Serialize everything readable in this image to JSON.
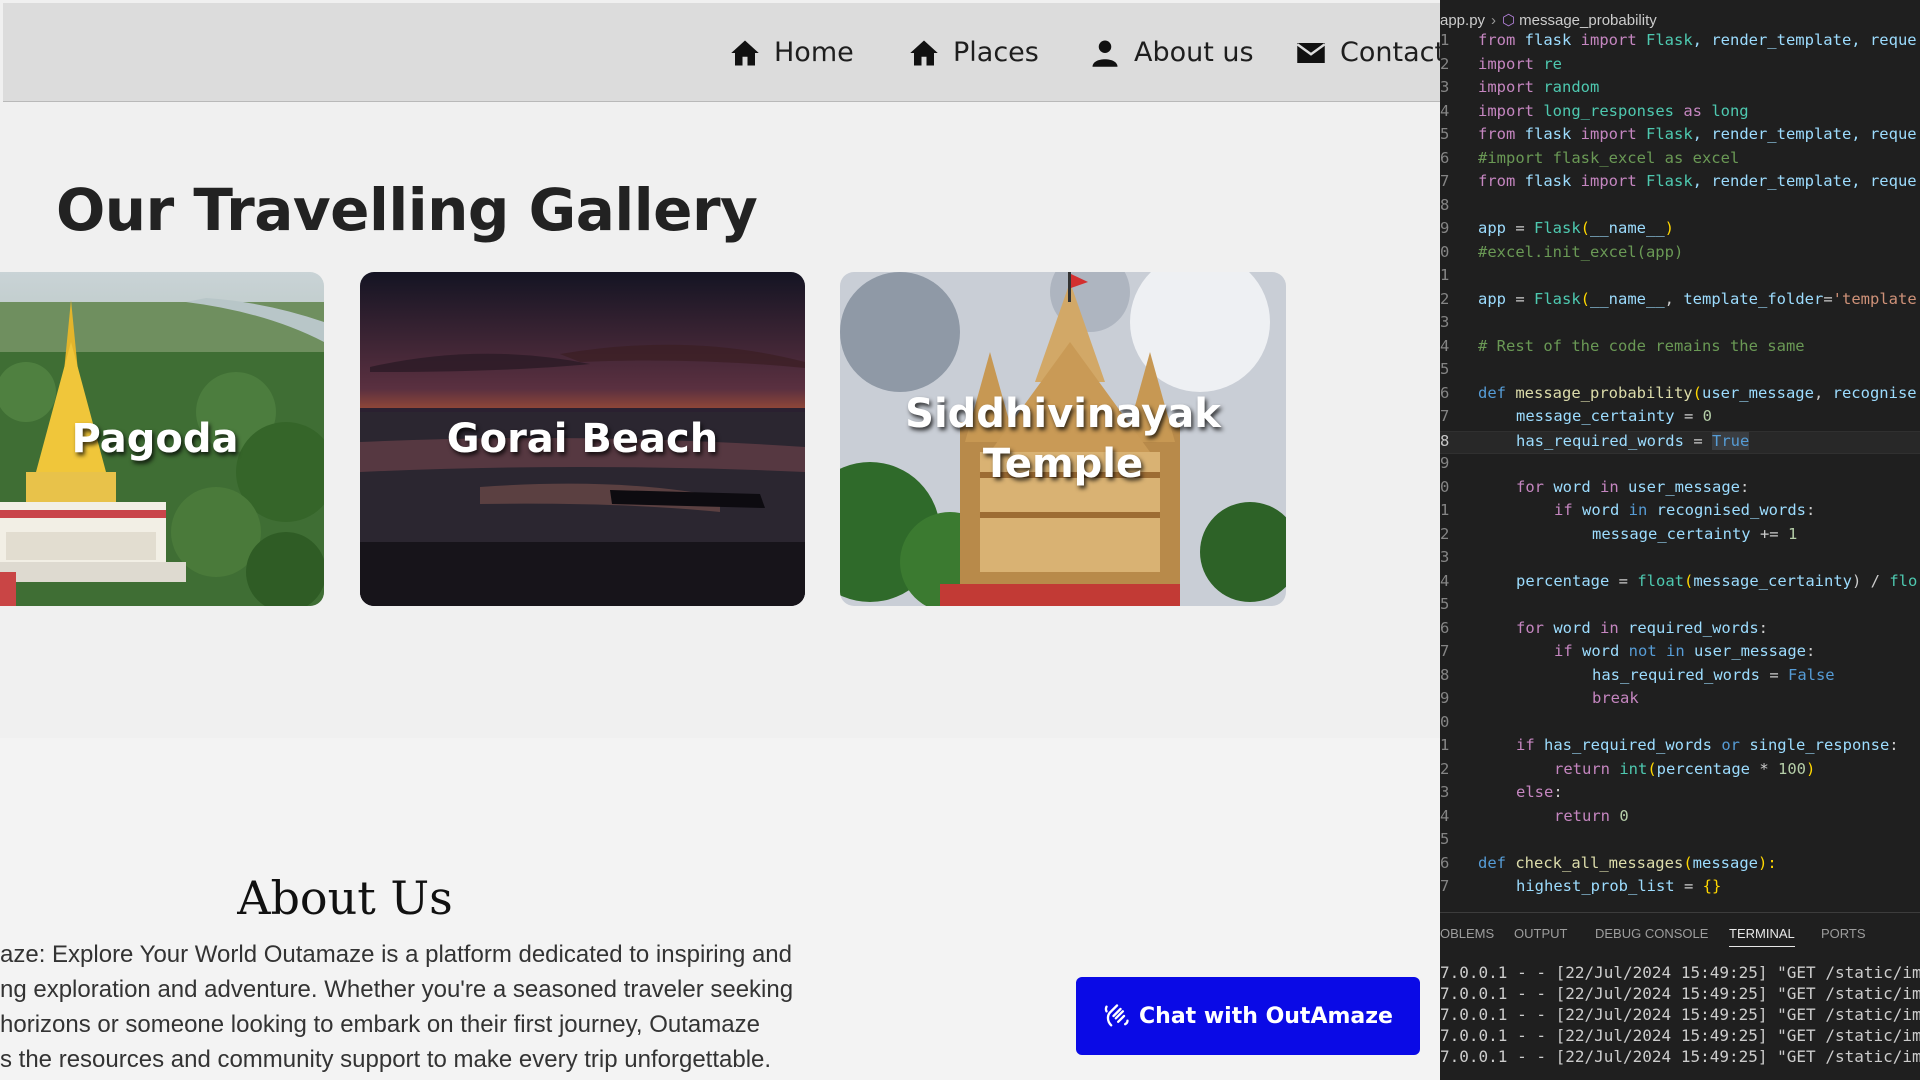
{
  "site": {
    "nav": [
      {
        "label": "Home",
        "icon": "home-icon"
      },
      {
        "label": "Places",
        "icon": "home-icon"
      },
      {
        "label": "About us",
        "icon": "user-icon"
      },
      {
        "label": "Contact",
        "icon": "envelope-icon"
      }
    ],
    "gallery_title": "Our Travelling Gallery",
    "cards": [
      {
        "label": "Pagoda"
      },
      {
        "label": "Gorai Beach"
      },
      {
        "label": "Siddhivinayak Temple"
      }
    ],
    "about_title": "About Us",
    "about_lines": [
      "aze: Explore Your World Outamaze is a platform dedicated to inspiring and",
      "ng exploration and adventure. Whether you're a seasoned traveler seeking",
      "horizons or someone looking to embark on their first journey, Outamaze",
      "s the resources and community support to make every trip unforgettable."
    ],
    "chat_button": "Chat with OutAmaze",
    "colors": {
      "chat_button": "#0a0ae6",
      "navbar": "#dcdcdc",
      "page_bg": "#f0f0f0"
    }
  },
  "editor": {
    "breadcrumb_file": "app.py",
    "breadcrumb_symbol": "message_probability",
    "line_numbers": [
      "1",
      "2",
      "3",
      "4",
      "5",
      "6",
      "7",
      "8",
      "9",
      "0",
      "1",
      "2",
      "3",
      "4",
      "5",
      "6",
      "7",
      "8",
      "9",
      "0",
      "1",
      "2",
      "3",
      "4",
      "5",
      "6",
      "7",
      "8",
      "9",
      "0",
      "1",
      "2",
      "3",
      "4",
      "5",
      "6",
      "7"
    ],
    "code": {
      "c1a": "from",
      "c1b": " flask ",
      "c1c": "import",
      "c1d": " Flask",
      "c1e": ", render_template, reque",
      "c2a": "import",
      "c2b": " re",
      "c3a": "import",
      "c3b": " random",
      "c4a": "import",
      "c4b": " long_responses ",
      "c4c": "as",
      "c4d": " long",
      "c5a": "from",
      "c5b": " flask ",
      "c5c": "import",
      "c5d": " Flask",
      "c5e": ", render_template, reque",
      "c6": "#import flask_excel as excel",
      "c7a": "from",
      "c7b": " flask ",
      "c7c": "import",
      "c7d": " Flask",
      "c7e": ", render_template, reque",
      "c9a": "app",
      "c9b": " = ",
      "c9c": "Flask",
      "c9d": "(",
      "c9e": "__name__",
      "c9f": ")",
      "c10": "#excel.init_excel(app)",
      "c12a": "app",
      "c12b": " = ",
      "c12c": "Flask",
      "c12d": "(",
      "c12e": "__name__",
      "c12f": ", ",
      "c12g": "template_folder",
      "c12h": "=",
      "c12i": "'template",
      "c14": "# Rest of the code remains the same",
      "c16a": "def",
      "c16b": " message_probability",
      "c16c": "(",
      "c16d": "user_message",
      "c16e": ", ",
      "c16f": "recognise",
      "c17a": "message_certainty",
      "c17b": " = ",
      "c17c": "0",
      "c18a": "has_required_words",
      "c18b": " = ",
      "c18c": "True",
      "c20a": "for",
      "c20b": " word ",
      "c20c": "in",
      "c20d": " user_message",
      "c20e": ":",
      "c21a": "if",
      "c21b": " word ",
      "c21c": "in",
      "c21d": " recognised_words",
      "c21e": ":",
      "c22a": "message_certainty",
      "c22b": " += ",
      "c22c": "1",
      "c24a": "percentage",
      "c24b": " = ",
      "c24c": "float",
      "c24d": "(",
      "c24e": "message_certainty",
      "c24f": ") / ",
      "c24g": "flo",
      "c26a": "for",
      "c26b": " word ",
      "c26c": "in",
      "c26d": " required_words",
      "c26e": ":",
      "c27a": "if",
      "c27b": " word ",
      "c27c": "not in",
      "c27d": " user_message",
      "c27e": ":",
      "c28a": "has_required_words",
      "c28b": " = ",
      "c28c": "False",
      "c29": "break",
      "c31a": "if",
      "c31b": " has_required_words ",
      "c31c": "or",
      "c31d": " single_response",
      "c31e": ":",
      "c32a": "return",
      "c32b": " int",
      "c32c": "(",
      "c32d": "percentage",
      "c32e": " * ",
      "c32f": "100",
      "c32g": ")",
      "c33a": "else",
      "c33b": ":",
      "c34a": "return",
      "c34b": " 0",
      "c36a": "def",
      "c36b": " check_all_messages",
      "c36c": "(",
      "c36d": "message",
      "c36e": "):",
      "c37a": "highest_prob_list",
      "c37b": " = ",
      "c37c": "{}"
    },
    "panel_tabs": [
      "OBLEMS",
      "OUTPUT",
      "DEBUG CONSOLE",
      "TERMINAL",
      "PORTS"
    ],
    "active_tab": "TERMINAL",
    "terminal_lines": [
      "7.0.0.1 - - [22/Jul/2024 15:49:25] \"GET /static/ima",
      "7.0.0.1 - - [22/Jul/2024 15:49:25] \"GET /static/ima",
      "7.0.0.1 - - [22/Jul/2024 15:49:25] \"GET /static/ima",
      "7.0.0.1 - - [22/Jul/2024 15:49:25] \"GET /static/ima",
      "7.0.0.1 - - [22/Jul/2024 15:49:25] \"GET /static/ima"
    ],
    "colors": {
      "background": "#1f1f1f",
      "keyword": "#569cd6",
      "control": "#c586c0",
      "function": "#dcdcaa",
      "class": "#4ec9b0",
      "variable": "#9cdcfe",
      "string": "#ce9178",
      "number": "#b5cea8",
      "comment": "#6a9955"
    }
  }
}
